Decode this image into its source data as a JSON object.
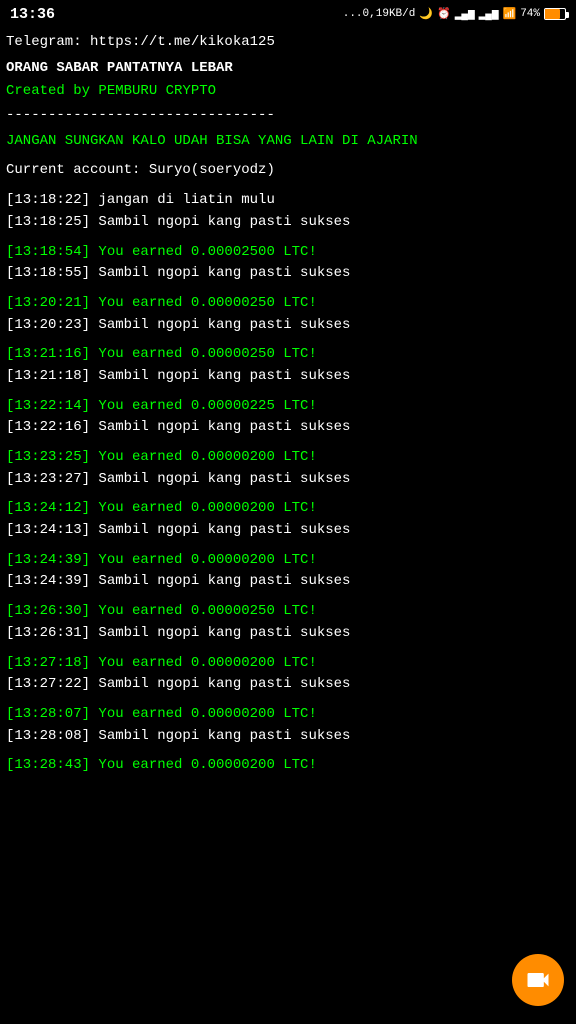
{
  "statusBar": {
    "time": "13:36",
    "network": "...0,19KB/d",
    "battery": "74%"
  },
  "header": {
    "telegram": "Telegram: https://t.me/kikoka125",
    "heading": "ORANG SABAR PANTATNYA LEBAR",
    "created": "Created by PEMBURU CRYPTO",
    "divider": "--------------------------------",
    "warning": "JANGAN SUNGKAN KALO UDAH BISA YANG LAIN DI AJARIN",
    "account": "Current account: Suryo(soeryodz)"
  },
  "logs": [
    {
      "time": "[13:18:22]",
      "msg": " jangan di liatin mulu",
      "earned": false
    },
    {
      "time": "[13:18:25]",
      "msg": " Sambil ngopi kang pasti sukses",
      "earned": false
    },
    {
      "time": "[13:18:54]",
      "msg": " You earned 0.00002500 LTC!",
      "earned": true
    },
    {
      "time": "[13:18:55]",
      "msg": " Sambil ngopi kang pasti sukses",
      "earned": false
    },
    {
      "time": "[13:20:21]",
      "msg": " You earned 0.00000250 LTC!",
      "earned": true
    },
    {
      "time": "[13:20:23]",
      "msg": " Sambil ngopi kang pasti sukses",
      "earned": false
    },
    {
      "time": "[13:21:16]",
      "msg": " You earned 0.00000250 LTC!",
      "earned": true
    },
    {
      "time": "[13:21:18]",
      "msg": " Sambil ngopi kang pasti sukses",
      "earned": false
    },
    {
      "time": "[13:22:14]",
      "msg": " You earned 0.00000225 LTC!",
      "earned": true
    },
    {
      "time": "[13:22:16]",
      "msg": " Sambil ngopi kang pasti sukses",
      "earned": false
    },
    {
      "time": "[13:23:25]",
      "msg": " You earned 0.00000200 LTC!",
      "earned": true
    },
    {
      "time": "[13:23:27]",
      "msg": " Sambil ngopi kang pasti sukses",
      "earned": false
    },
    {
      "time": "[13:24:12]",
      "msg": " You earned 0.00000200 LTC!",
      "earned": true
    },
    {
      "time": "[13:24:13]",
      "msg": " Sambil ngopi kang pasti sukses",
      "earned": false
    },
    {
      "time": "[13:24:39]",
      "msg": " You earned 0.00000200 LTC!",
      "earned": true
    },
    {
      "time": "[13:24:39]",
      "msg": " Sambil ngopi kang pasti sukses",
      "earned": false
    },
    {
      "time": "[13:26:30]",
      "msg": " You earned 0.00000250 LTC!",
      "earned": true
    },
    {
      "time": "[13:26:31]",
      "msg": " Sambil ngopi kang pasti sukses",
      "earned": false
    },
    {
      "time": "[13:27:18]",
      "msg": " You earned 0.00000200 LTC!",
      "earned": true
    },
    {
      "time": "[13:27:22]",
      "msg": " Sambil ngopi kang pasti sukses",
      "earned": false
    },
    {
      "time": "[13:28:07]",
      "msg": " You earned 0.00000200 LTC!",
      "earned": true
    },
    {
      "time": "[13:28:08]",
      "msg": " Sambil ngopi kang pasti sukses",
      "earned": false
    },
    {
      "time": "[13:28:43]",
      "msg": " You earned 0.00000200 LTC!",
      "earned": true
    }
  ]
}
